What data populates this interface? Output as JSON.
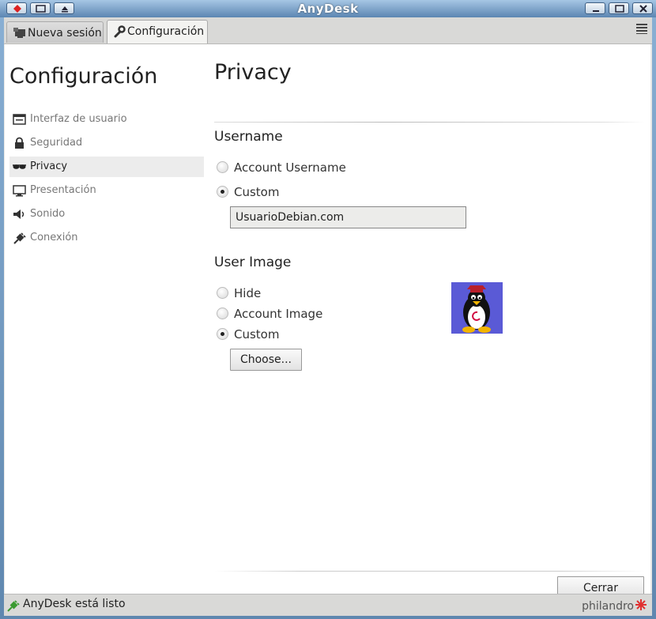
{
  "window": {
    "title": "AnyDesk"
  },
  "tabs": [
    {
      "label": "Nueva sesión",
      "icon": "monitor-icon",
      "active": false
    },
    {
      "label": "Configuración",
      "icon": "wrench-icon",
      "active": true
    }
  ],
  "sidebar": {
    "title": "Configuración",
    "items": [
      {
        "label": "Interfaz de usuario",
        "icon": "window-icon",
        "selected": false
      },
      {
        "label": "Seguridad",
        "icon": "lock-icon",
        "selected": false
      },
      {
        "label": "Privacy",
        "icon": "sunglasses-icon",
        "selected": true
      },
      {
        "label": "Presentación",
        "icon": "monitor-icon",
        "selected": false
      },
      {
        "label": "Sonido",
        "icon": "speaker-icon",
        "selected": false
      },
      {
        "label": "Conexión",
        "icon": "plug-icon",
        "selected": false
      }
    ]
  },
  "main": {
    "title": "Privacy",
    "username": {
      "heading": "Username",
      "options": [
        {
          "label": "Account Username",
          "checked": false
        },
        {
          "label": "Custom",
          "checked": true
        }
      ],
      "value": "UsuarioDebian.com"
    },
    "user_image": {
      "heading": "User Image",
      "options": [
        {
          "label": "Hide",
          "checked": false
        },
        {
          "label": "Account Image",
          "checked": false
        },
        {
          "label": "Custom",
          "checked": true
        }
      ],
      "choose_label": "Choose...",
      "image": "tux-debian-avatar"
    }
  },
  "footer": {
    "close_label": "Cerrar"
  },
  "status": {
    "text": "AnyDesk está listo",
    "icon": "plug-icon",
    "brand": "philandro"
  },
  "colors": {
    "titlebar": "#5c86b2",
    "avatar_bg": "#5a5ad6",
    "brand_red": "#e03030"
  }
}
